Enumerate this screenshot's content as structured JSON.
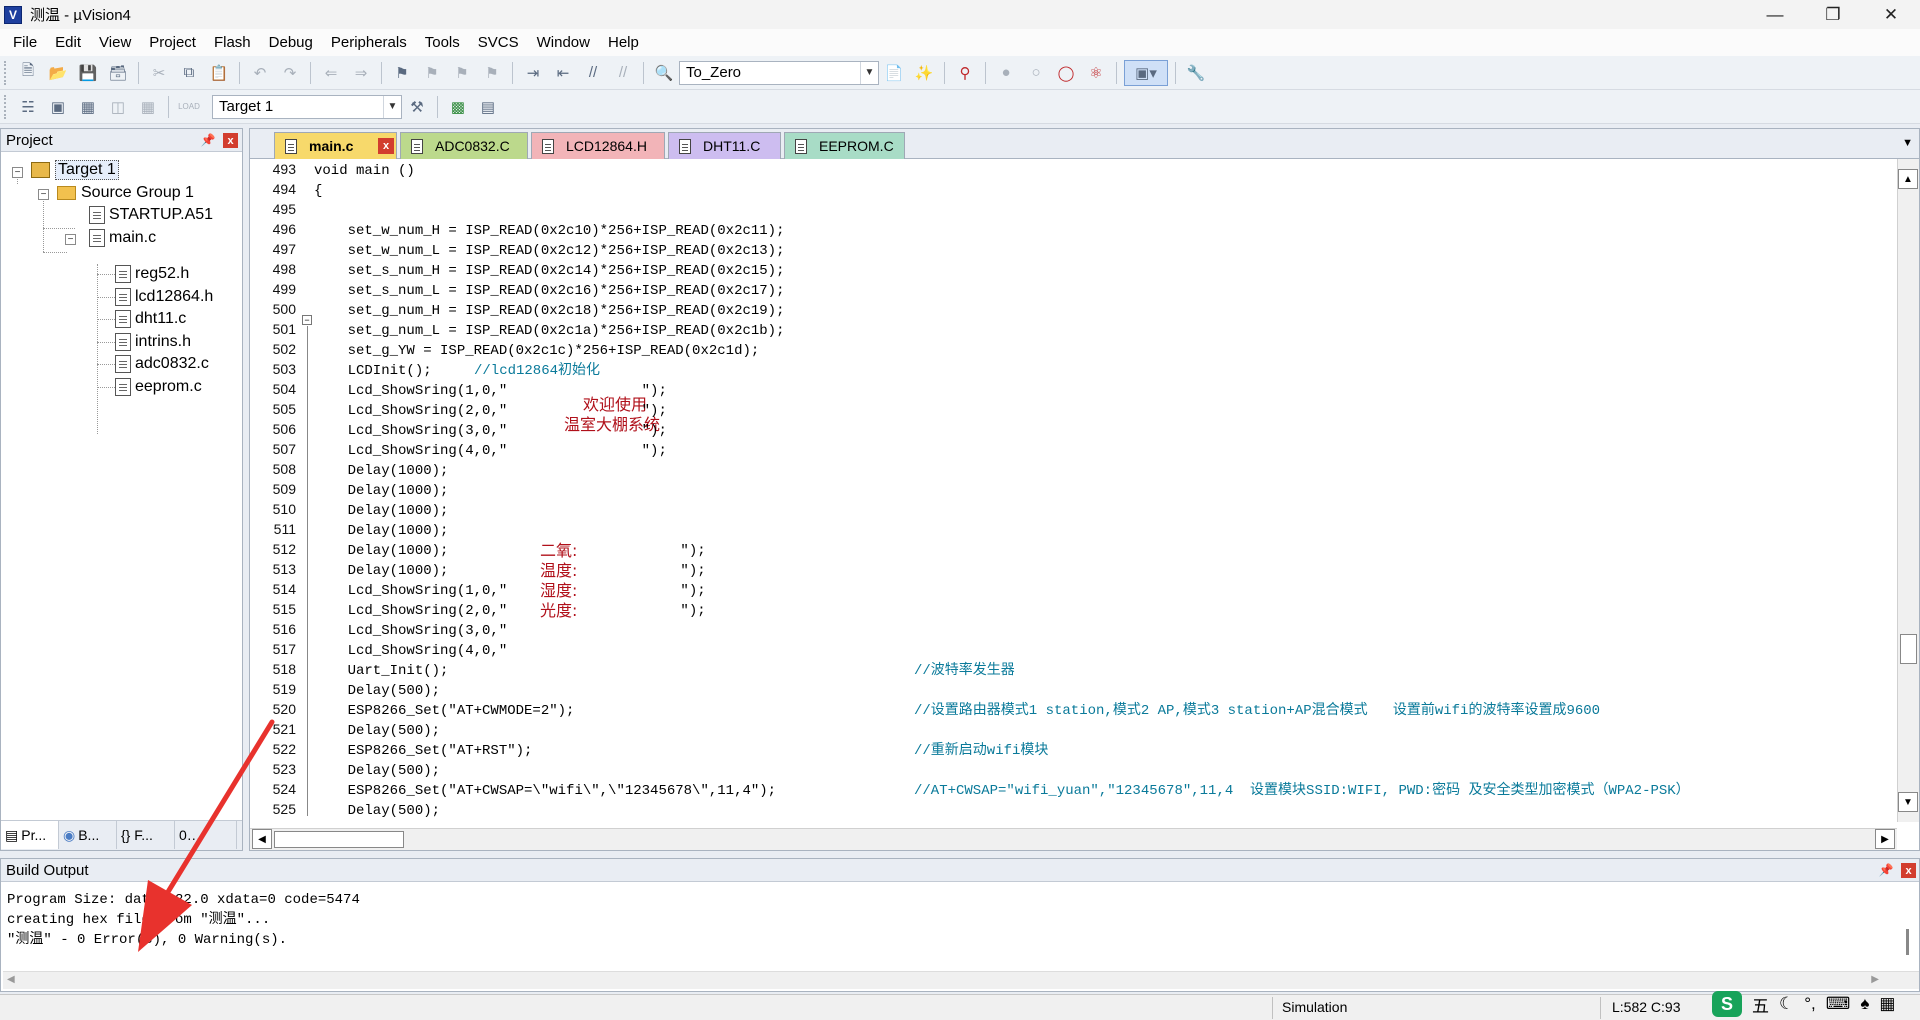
{
  "window": {
    "title": "测温 - µVision4",
    "app_icon": "V"
  },
  "menu": [
    "File",
    "Edit",
    "View",
    "Project",
    "Flash",
    "Debug",
    "Peripherals",
    "Tools",
    "SVCS",
    "Window",
    "Help"
  ],
  "toolbar": {
    "find_combo": "To_Zero",
    "target_combo": "Target 1",
    "load_label": "LOAD"
  },
  "project_panel": {
    "title": "Project",
    "tree": {
      "target": "Target 1",
      "group": "Source Group 1",
      "startup": "STARTUP.A51",
      "main": "main.c",
      "includes": [
        "reg52.h",
        "lcd12864.h",
        "dht11.c",
        "intrins.h",
        "adc0832.c",
        "eeprom.c"
      ]
    },
    "tabs": [
      "Pr...",
      "B...",
      "{} F...",
      "0…"
    ]
  },
  "editor": {
    "tabs": [
      {
        "label": "main.c",
        "color": "#f7d96b"
      },
      {
        "label": "ADC0832.C",
        "color": "#bcd98c"
      },
      {
        "label": "LCD12864.H",
        "color": "#f2b4b8"
      },
      {
        "label": "DHT11.C",
        "color": "#cdbdf0"
      },
      {
        "label": "EEPROM.C",
        "color": "#a8dcc6"
      }
    ],
    "line_numbers": [
      "493",
      "494",
      "495",
      "496",
      "497",
      "498",
      "499",
      "500",
      "501",
      "502",
      "503",
      "504",
      "505",
      "506",
      "507",
      "508",
      "509",
      "510",
      "511",
      "512",
      "513",
      "514",
      "515",
      "516",
      "517",
      "518",
      "519",
      "520",
      "521",
      "522",
      "523",
      "524",
      "525"
    ],
    "code": [
      "void main ()",
      "{",
      "",
      "    set_w_num_H = ISP_READ(0x2c10)*256+ISP_READ(0x2c11);",
      "    set_w_num_L = ISP_READ(0x2c12)*256+ISP_READ(0x2c13);",
      "    set_s_num_H = ISP_READ(0x2c14)*256+ISP_READ(0x2c15);",
      "    set_s_num_L = ISP_READ(0x2c16)*256+ISP_READ(0x2c17);",
      "    set_g_num_H = ISP_READ(0x2c18)*256+ISP_READ(0x2c19);",
      "    set_g_num_L = ISP_READ(0x2c1a)*256+ISP_READ(0x2c1b);",
      "    set_g_YW = ISP_READ(0x2c1c)*256+ISP_READ(0x2c1d);",
      "    LCDInit();",
      "    Lcd_ShowSring(1,0,\"                \");",
      "    Lcd_ShowSring(2,0,\"                \");",
      "    Lcd_ShowSring(3,0,\"                \");",
      "    Lcd_ShowSring(4,0,\"                \");",
      "    Delay(1000);",
      "    Delay(1000);",
      "    Delay(1000);",
      "    Delay(1000);",
      "    Delay(1000);",
      "    Delay(1000);",
      "    Lcd_ShowSring(1,0,\"        ",
      "    Lcd_ShowSring(2,0,\"        ",
      "    Lcd_ShowSring(3,0,\"        ",
      "    Lcd_ShowSring(4,0,\"        ",
      "    Uart_Init();",
      "    Delay(500);",
      "    ESP8266_Set(\"AT+CWMODE=2\");",
      "    Delay(500);",
      "    ESP8266_Set(\"AT+RST\");",
      "    Delay(500);",
      "    ESP8266_Set(\"AT+CWSAP=\\\"wifi\\\",\\\"12345678\\\",11,4\");",
      "    Delay(500);"
    ],
    "inline_comments": {
      "lcdinit": "//lcd12864初始化",
      "welcome": "欢迎使用",
      "system_name": "温室大棚系统",
      "co2": "二氧:",
      "temp": "温度:",
      "humid": "湿度:",
      "light": "光度:",
      "lcd_tail": "           \");",
      "c518": "//波特率发生器",
      "c520": "//设置路由器模式1 station,模式2 AP,模式3 station+AP混合模式   设置前wifi的波特率设置成9600",
      "c522": "//重新启动wifi模块",
      "c524": "//AT+CWSAP=\"wifi_yuan\",\"12345678\",11,4  设置模块SSID:WIFI, PWD:密码 及安全类型加密模式（WPA2-PSK）"
    }
  },
  "build_output": {
    "title": "Build Output",
    "lines": [
      "Program Size: data=122.0 xdata=0 code=5474",
      "creating hex file from \"测温\"...",
      "\"测温\" - 0 Error(s), 0 Warning(s)."
    ]
  },
  "statusbar": {
    "mode": "Simulation",
    "position": "L:582 C:93"
  },
  "ime": {
    "logo": "S",
    "mode": "五"
  },
  "annotation": {
    "arrow_color": "#e8322d"
  }
}
